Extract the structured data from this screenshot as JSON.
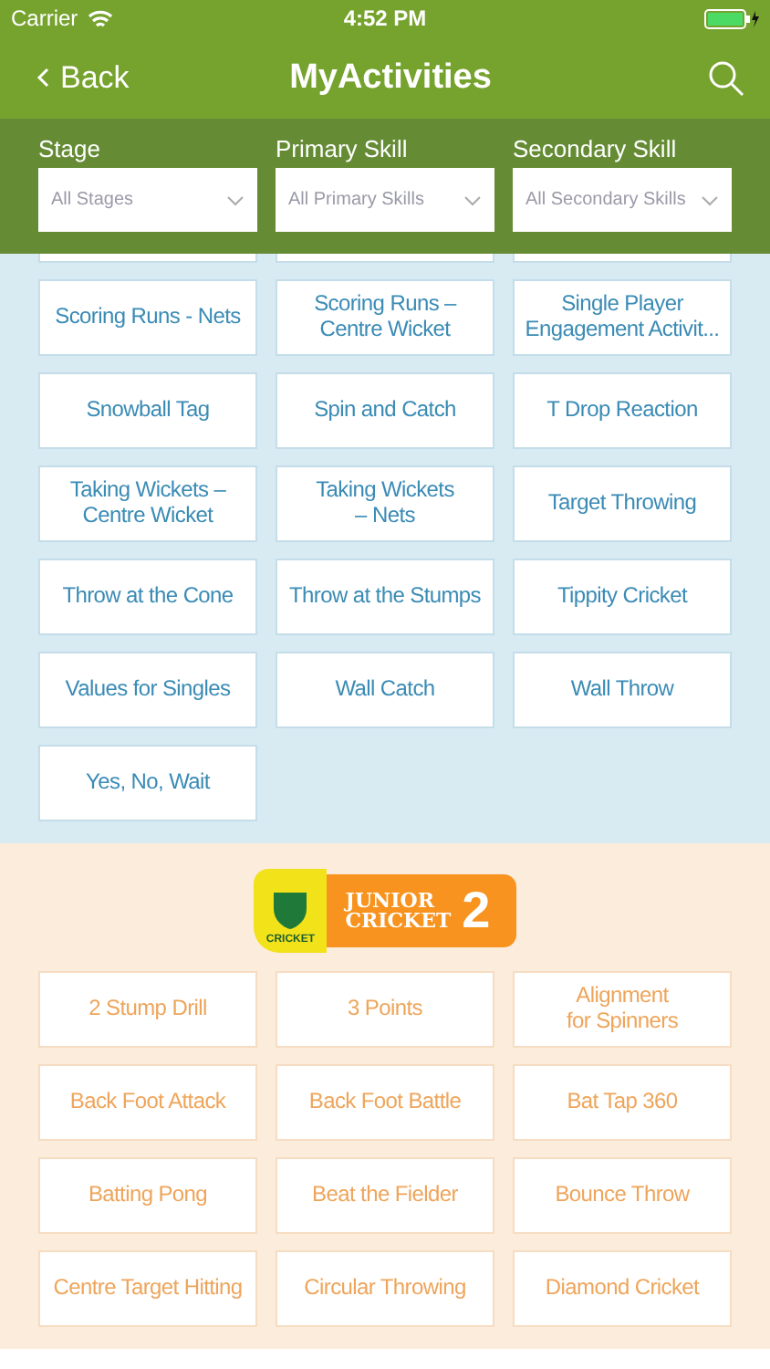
{
  "status_bar": {
    "carrier": "Carrier",
    "time": "4:52 PM"
  },
  "nav": {
    "back": "Back",
    "title": "MyActivities"
  },
  "filters": [
    {
      "label": "Stage",
      "placeholder": "All Stages"
    },
    {
      "label": "Primary Skill",
      "placeholder": "All Primary Skills"
    },
    {
      "label": "Secondary Skill",
      "placeholder": "All Secondary Skills"
    }
  ],
  "sections": [
    {
      "kind": "plain",
      "activities": [
        "Scoring Runs - Nets",
        "Scoring Runs –\nCentre Wicket",
        "Single Player\nEngagement Activit...",
        "Snowball Tag",
        "Spin and Catch",
        "T Drop Reaction",
        "Taking Wickets –\nCentre Wicket",
        "Taking Wickets\n– Nets",
        "Target Throwing",
        "Throw at the Cone",
        "Throw at the Stumps",
        "Tippity Cricket",
        "Values for Singles",
        "Wall Catch",
        "Wall Throw",
        "Yes, No, Wait"
      ]
    },
    {
      "kind": "badge",
      "badge": {
        "shield": "CRICKET",
        "line1": "JUNIOR",
        "line2": "CRICKET",
        "number": "2"
      },
      "activities": [
        "2 Stump Drill",
        "3 Points",
        "Alignment\nfor Spinners",
        "Back Foot Attack",
        "Back Foot Battle",
        "Bat Tap 360",
        "Batting Pong",
        "Beat the Fielder",
        "Bounce Throw",
        "Centre Target Hitting",
        "Circular Throwing",
        "Diamond Cricket"
      ]
    }
  ]
}
